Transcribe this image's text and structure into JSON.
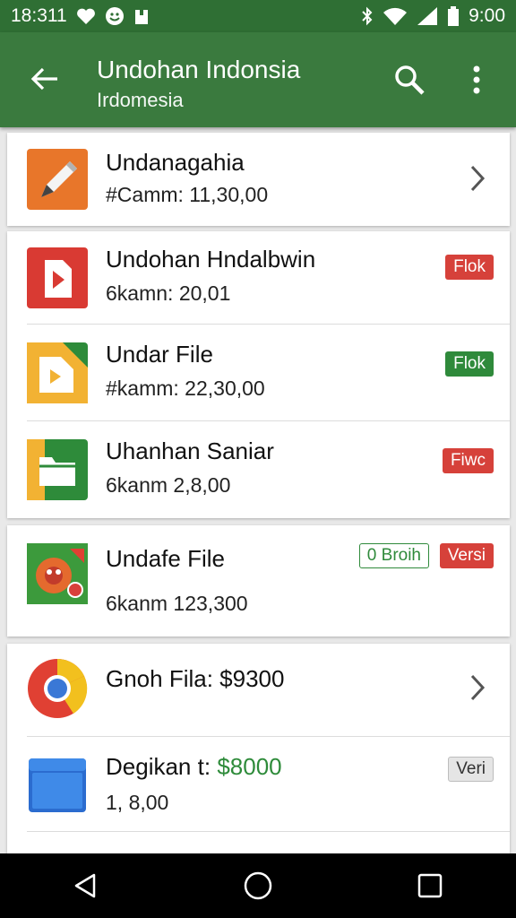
{
  "status": {
    "time": "18:311",
    "clock": "9:00"
  },
  "appbar": {
    "title": "Undohan Indonsia",
    "subtitle": "Irdomesia"
  },
  "cards": [
    {
      "items": [
        {
          "name": "Undanagahia",
          "meta": "#Camm: 11,30,00"
        }
      ]
    },
    {
      "items": [
        {
          "name": "Undohan Hndalbwin",
          "meta": "6kamn: 20,01",
          "badge": "Flok"
        },
        {
          "name": "Undar File",
          "meta": "#kamm: 22,30,00",
          "badge": "Flok"
        },
        {
          "name": "Uhanhan Saniar",
          "meta": "6kanm 2,8,00",
          "badge": "Fiwc"
        }
      ]
    },
    {
      "items": [
        {
          "name": "Undafe File",
          "meta": "6kanm 123,300",
          "badge1": "0 Broih",
          "badge2": "Versi"
        }
      ]
    },
    {
      "items": [
        {
          "name": "Gnoh Fila: $9300"
        },
        {
          "name": "Degikan t:",
          "price": "$8000",
          "meta": "1, 8,00",
          "badge": "Veri"
        }
      ]
    }
  ],
  "colors": {
    "appbar": "#3a7a3e",
    "statusbar": "#2f6f34",
    "accent_green": "#2f8a3b",
    "accent_red": "#d6413a"
  },
  "icons": [
    "back-arrow-icon",
    "search-icon",
    "more-vert-icon",
    "chevron-right-icon",
    "nav-back-icon",
    "nav-home-icon",
    "nav-recents-icon"
  ]
}
